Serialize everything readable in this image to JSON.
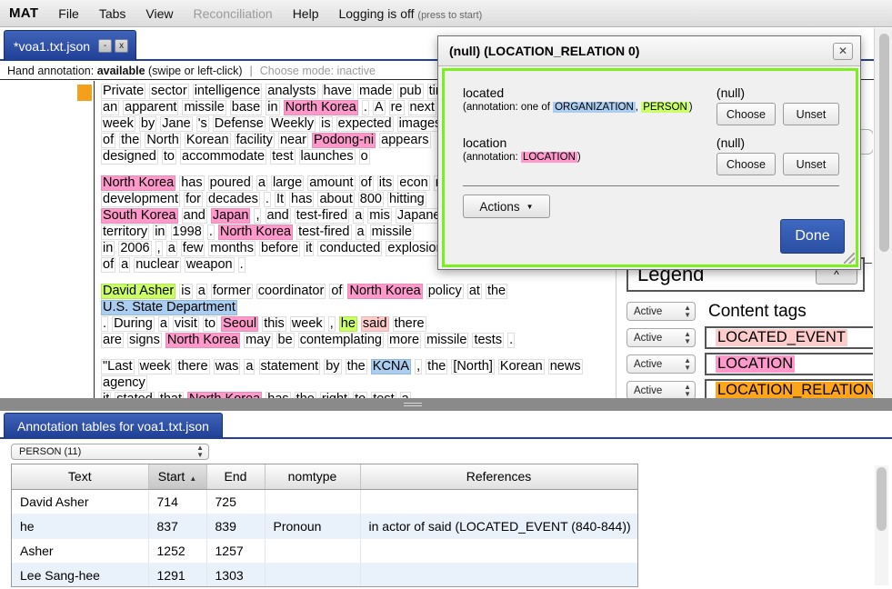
{
  "menubar": {
    "brand": "MAT",
    "items": [
      {
        "label": "File",
        "disabled": false
      },
      {
        "label": "Tabs",
        "disabled": false
      },
      {
        "label": "View",
        "disabled": false
      },
      {
        "label": "Reconciliation",
        "disabled": true
      },
      {
        "label": "Help",
        "disabled": false
      }
    ],
    "logging_label": "Logging is off",
    "logging_hint": "(press to start)"
  },
  "document_tab": {
    "name": "*voa1.txt.json",
    "minimize_label": "-",
    "close_label": "x"
  },
  "statusline": {
    "prefix": "Hand annotation:",
    "state": "available",
    "mode_hint": "(swipe or left-click)",
    "separator": "|",
    "choose_mode": "Choose mode: inactive"
  },
  "document_text": {
    "paragraphs": [
      [
        [
          "Private",
          ""
        ],
        [
          "sector",
          ""
        ],
        [
          "intelligence",
          ""
        ],
        [
          "analysts",
          ""
        ],
        [
          "have",
          ""
        ],
        [
          "made",
          ""
        ],
        [
          "pub",
          ""
        ],
        [
          "time",
          "\n"
        ],
        [
          "an",
          ""
        ],
        [
          "apparent",
          ""
        ],
        [
          "missile",
          ""
        ],
        [
          "base",
          ""
        ],
        [
          "in",
          ""
        ],
        [
          "North Korea",
          "LOCATION"
        ],
        [
          ".",
          ""
        ],
        [
          "A",
          ""
        ],
        [
          "re",
          ""
        ],
        [
          "next",
          "\n"
        ],
        [
          "week",
          ""
        ],
        [
          "by",
          ""
        ],
        [
          "Jane",
          ""
        ],
        [
          "'s",
          ""
        ],
        [
          "Defense",
          ""
        ],
        [
          "Weekly",
          ""
        ],
        [
          "is",
          ""
        ],
        [
          "expected",
          ""
        ],
        [
          "images",
          "\n"
        ],
        [
          "of",
          ""
        ],
        [
          "the",
          ""
        ],
        [
          "North",
          ""
        ],
        [
          "Korean",
          ""
        ],
        [
          "facility",
          ""
        ],
        [
          "near",
          ""
        ],
        [
          "Podong-ni",
          "LOCATION"
        ],
        [
          "appears",
          "\n"
        ],
        [
          "designed",
          ""
        ],
        [
          "to",
          ""
        ],
        [
          "accommodate",
          ""
        ],
        [
          "test",
          ""
        ],
        [
          "launches",
          ""
        ],
        [
          "o",
          ""
        ]
      ],
      [
        [
          "North Korea",
          "LOCATION"
        ],
        [
          "has",
          ""
        ],
        [
          "poured",
          ""
        ],
        [
          "a",
          ""
        ],
        [
          "large",
          ""
        ],
        [
          "amount",
          ""
        ],
        [
          "of",
          ""
        ],
        [
          "its",
          ""
        ],
        [
          "econ",
          ""
        ],
        [
          "missile",
          "\n"
        ],
        [
          "development",
          ""
        ],
        [
          "for",
          ""
        ],
        [
          "decades",
          ""
        ],
        [
          ".",
          ""
        ],
        [
          "It",
          ""
        ],
        [
          "has",
          ""
        ],
        [
          "about",
          ""
        ],
        [
          "800",
          ""
        ],
        [
          "hitting",
          "\n"
        ],
        [
          "South Korea",
          "LOCATION"
        ],
        [
          "and",
          ""
        ],
        [
          "Japan",
          "LOCATION"
        ],
        [
          ",",
          ""
        ],
        [
          "and",
          ""
        ],
        [
          "test-fired",
          ""
        ],
        [
          "a",
          ""
        ],
        [
          "mis",
          ""
        ],
        [
          "Japanese",
          "\n"
        ],
        [
          "territory",
          ""
        ],
        [
          "in",
          ""
        ],
        [
          "1998",
          ""
        ],
        [
          ".",
          ""
        ],
        [
          "North Korea",
          "LOCATION"
        ],
        [
          "test-fired",
          ""
        ],
        [
          "a",
          ""
        ],
        [
          "missile",
          "\n"
        ],
        [
          "in",
          ""
        ],
        [
          "2006",
          ""
        ],
        [
          ",",
          ""
        ],
        [
          "a",
          ""
        ],
        [
          "few",
          ""
        ],
        [
          "months",
          ""
        ],
        [
          "before",
          ""
        ],
        [
          "it",
          ""
        ],
        [
          "conducted",
          ""
        ],
        [
          "explosion",
          "\n"
        ],
        [
          "of",
          ""
        ],
        [
          "a",
          ""
        ],
        [
          "nuclear",
          ""
        ],
        [
          "weapon",
          ""
        ],
        [
          ".",
          ""
        ]
      ],
      [
        [
          "David Asher",
          "PERSON"
        ],
        [
          "is",
          ""
        ],
        [
          "a",
          ""
        ],
        [
          "former",
          ""
        ],
        [
          "coordinator",
          ""
        ],
        [
          "of",
          ""
        ],
        [
          "North Korea",
          "LOCATION"
        ],
        [
          "policy",
          ""
        ],
        [
          "at",
          ""
        ],
        [
          "the",
          ""
        ],
        [
          "U.S. State Department",
          "ORGANIZATION\n"
        ],
        [
          ".",
          ""
        ],
        [
          "During",
          ""
        ],
        [
          "a",
          ""
        ],
        [
          "visit",
          ""
        ],
        [
          "to",
          ""
        ],
        [
          "Seoul",
          "LOCATION"
        ],
        [
          "this",
          ""
        ],
        [
          "week",
          ""
        ],
        [
          ",",
          ""
        ],
        [
          "he",
          "PERSON"
        ],
        [
          "said",
          "LOCATED_EVENT"
        ],
        [
          "there",
          "\n"
        ],
        [
          "are",
          ""
        ],
        [
          "signs",
          ""
        ],
        [
          "North Korea",
          "LOCATION"
        ],
        [
          "may",
          ""
        ],
        [
          "be",
          ""
        ],
        [
          "contemplating",
          ""
        ],
        [
          "more",
          ""
        ],
        [
          "missile",
          ""
        ],
        [
          "tests",
          ""
        ],
        [
          ".",
          ""
        ]
      ],
      [
        [
          "\"Last",
          ""
        ],
        [
          "week",
          ""
        ],
        [
          "there",
          ""
        ],
        [
          "was",
          ""
        ],
        [
          "a",
          ""
        ],
        [
          "statement",
          ""
        ],
        [
          "by",
          ""
        ],
        [
          "the",
          ""
        ],
        [
          "KCNA",
          "ORGANIZATION"
        ],
        [
          ",",
          ""
        ],
        [
          "the",
          ""
        ],
        [
          "[North]",
          ""
        ],
        [
          "Korean",
          ""
        ],
        [
          "news",
          "\n"
        ],
        [
          "agency",
          "\n"
        ],
        [
          "",
          ""
        ],
        [
          "it",
          ""
        ],
        [
          "stated",
          ""
        ],
        [
          "that",
          ""
        ],
        [
          "North Korea",
          "LOCATION"
        ],
        [
          "has",
          ""
        ],
        [
          "the",
          ""
        ],
        [
          "right",
          ""
        ],
        [
          "to",
          ""
        ],
        [
          "test",
          ""
        ],
        [
          "a",
          ""
        ]
      ]
    ]
  },
  "legend": {
    "title": "Legend",
    "collapse_icon": "^",
    "global_selector": "Active",
    "content_tags_label": "Content tags",
    "rows": [
      {
        "selector": "Active",
        "tag": "LOCATED_EVENT"
      },
      {
        "selector": "Active",
        "tag": "LOCATION"
      },
      {
        "selector": "Active",
        "tag": "LOCATION_RELATION"
      }
    ]
  },
  "dialog": {
    "title": "(null) (LOCATION_RELATION 0)",
    "close_label": "✕",
    "fields": [
      {
        "label": "located",
        "sub_prefix": "(annotation: one of ",
        "chips": [
          {
            "text": "ORGANIZATION",
            "type": "ORG"
          },
          {
            "text": "PERSON",
            "type": "PERSON"
          }
        ],
        "sub_suffix": ")",
        "value": "(null)",
        "choose_label": "Choose",
        "unset_label": "Unset"
      },
      {
        "label": "location",
        "sub_prefix": "(annotation: ",
        "chips": [
          {
            "text": "LOCATION",
            "type": "LOCATION"
          }
        ],
        "sub_suffix": ")",
        "value": "(null)",
        "choose_label": "Choose",
        "unset_label": "Unset"
      }
    ],
    "actions_label": "Actions",
    "actions_caret": "▼",
    "done_label": "Done"
  },
  "bottom": {
    "tab_label": "Annotation tables for voa1.txt.json",
    "type_selector": "PERSON (11)",
    "columns": [
      {
        "key": "text",
        "label": "Text",
        "sorted": false
      },
      {
        "key": "start",
        "label": "Start",
        "sorted": true,
        "sort_dir": "▲"
      },
      {
        "key": "end",
        "label": "End",
        "sorted": false
      },
      {
        "key": "nomtype",
        "label": "nomtype",
        "sorted": false
      },
      {
        "key": "references",
        "label": "References",
        "sorted": false
      }
    ],
    "rows": [
      {
        "text": "David Asher",
        "start": "714",
        "end": "725",
        "nomtype": "",
        "references": ""
      },
      {
        "text": "he",
        "start": "837",
        "end": "839",
        "nomtype": "Pronoun",
        "references": "in actor of said (LOCATED_EVENT (840-844))"
      },
      {
        "text": "Asher",
        "start": "1252",
        "end": "1257",
        "nomtype": "",
        "references": ""
      },
      {
        "text": "Lee Sang-hee",
        "start": "1291",
        "end": "1303",
        "nomtype": "",
        "references": ""
      }
    ]
  },
  "colors": {
    "location": "#ff99cc",
    "person": "#ccff66",
    "organization": "#aacdf0",
    "located_event": "#ffcccc",
    "location_relation": "#ffa519",
    "dialog_focus_border": "#7cf01e",
    "tab_blue": "#24409a",
    "marker_orange": "#f5a01a"
  }
}
